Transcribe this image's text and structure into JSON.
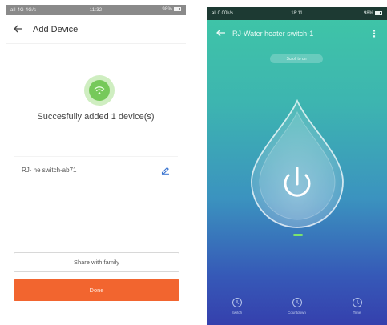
{
  "left_screen": {
    "status_bar": {
      "left": "all 4G 4G/s",
      "center": "11:32",
      "right": "98%"
    },
    "header": {
      "back_icon": "arrow-left-icon",
      "title": "Add Device"
    },
    "success_icon": "wifi-check-icon",
    "success_message": "Succesfully added 1 device(s)",
    "device": {
      "name": "RJ- he switch-ab71",
      "edit_icon": "pencil-icon"
    },
    "share_button": "Share with family",
    "done_button": "Done",
    "colors": {
      "accent": "#f2652f",
      "success": "#76c95a"
    }
  },
  "right_screen": {
    "status_bar": {
      "left": "all 0.00k/s",
      "center": "18:11",
      "right": "98%"
    },
    "header": {
      "back_icon": "arrow-left-icon",
      "title": "RJ-Water heater switch-1",
      "more_icon": "more-vertical-icon"
    },
    "status_pill": "Scroll to on",
    "power_icon": "power-icon",
    "bottom_nav": [
      {
        "label": "Switch",
        "icon": "clock-icon"
      },
      {
        "label": "Countdown",
        "icon": "clock-icon"
      },
      {
        "label": "Time",
        "icon": "clock-icon"
      }
    ],
    "colors": {
      "gradient_top": "#3fc6a6",
      "gradient_bottom": "#3540ad",
      "indicator": "#7be36d"
    }
  }
}
